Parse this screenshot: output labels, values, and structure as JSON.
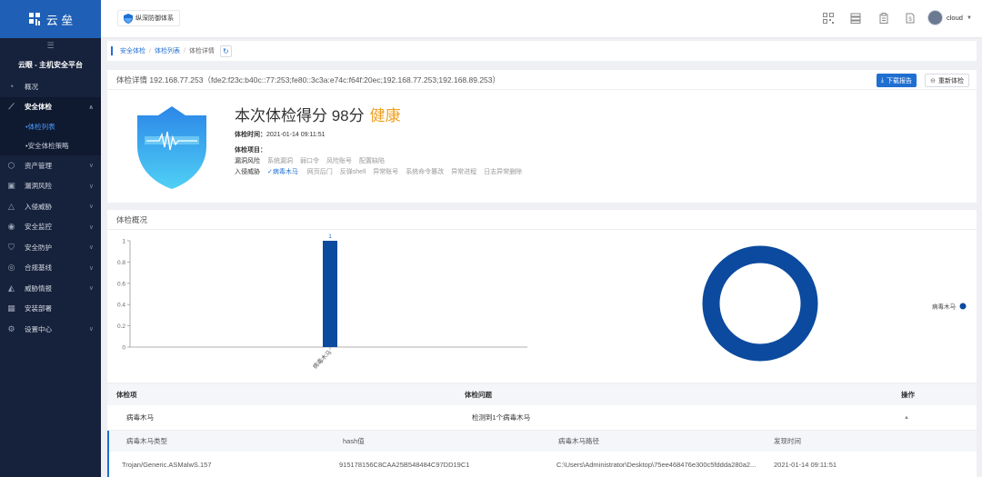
{
  "sidebar": {
    "logo_text": "云 垒",
    "platform": "云眼 - 主机安全平台",
    "items": [
      {
        "label": "概况",
        "icon": "dashboard-icon"
      },
      {
        "label": "安全体检",
        "icon": "trend-icon",
        "expanded": true
      },
      {
        "label": "资产管理",
        "icon": "cube-icon"
      },
      {
        "label": "漏洞风险",
        "icon": "lock-icon"
      },
      {
        "label": "入侵威胁",
        "icon": "warning-icon"
      },
      {
        "label": "安全监控",
        "icon": "eye-icon"
      },
      {
        "label": "安全防护",
        "icon": "shield-icon"
      },
      {
        "label": "合规基线",
        "icon": "radar-icon"
      },
      {
        "label": "威胁情报",
        "icon": "mountain-icon"
      },
      {
        "label": "安装部署",
        "icon": "grid-icon"
      },
      {
        "label": "设置中心",
        "icon": "gear-icon"
      }
    ],
    "submenu": [
      {
        "label": "•体检列表",
        "active": true
      },
      {
        "label": "•安全体检策略",
        "active": false
      }
    ]
  },
  "header": {
    "brand": "纵深防御体系",
    "user": "cloud"
  },
  "breadcrumb": {
    "items": [
      "安全体检",
      "体检列表",
      "体检详情"
    ]
  },
  "detail": {
    "title": "体检详情 192.168.77.253（fde2:f23c:b40c::77:253;fe80::3c3a:e74c:f64f:20ec;192.168.77.253;192.168.89.253）",
    "download_label": "下载报告",
    "recheck_label": "重新体检",
    "score_text": "本次体检得分 98分",
    "status_text": "健康",
    "time_label": "体检时间：",
    "time_value": "2021-01-14 09:11:51",
    "items_label": "体检项目：",
    "vuln_label": "漏洞风险",
    "vuln_items": [
      "系统漏洞",
      "弱口令",
      "风险账号",
      "配置缺陷"
    ],
    "intrusion_label": "入侵威胁",
    "intrusion_checked": "病毒木马",
    "intrusion_items": [
      "网页后门",
      "反弹shell",
      "异常账号",
      "系统命令篡改",
      "异常进程",
      "日志异常删除"
    ]
  },
  "overview": {
    "title": "体检概况"
  },
  "chart_data": [
    {
      "type": "bar",
      "categories": [
        "病毒木马"
      ],
      "values": [
        1
      ],
      "ylim": [
        0,
        1
      ],
      "yticks": [
        "0",
        "0.2",
        "0.4",
        "0.6",
        "0.8",
        "1"
      ],
      "data_labels": [
        "1"
      ],
      "color": "#0b4a9e"
    },
    {
      "type": "pie",
      "variant": "donut",
      "slices": [
        {
          "label": "病毒木马",
          "value": 1
        }
      ],
      "legend": "right",
      "color": "#0b4a9e"
    }
  ],
  "table": {
    "headers": [
      "体检项",
      "体检问题",
      "操作"
    ],
    "row": {
      "item": "病毒木马",
      "issue": "检测到1个病毒木马"
    },
    "sub_headers": [
      "病毒木马类型",
      "hash值",
      "病毒木马路径",
      "发现时间"
    ],
    "sub_row": {
      "type": "Trojan/Generic.ASMalwS.157",
      "hash": "915178156C8CAA25B548484C97DD19C1",
      "path": "C:\\Users\\Administrator\\Desktop\\75ee468476e300c5fddda280a2...",
      "time": "2021-01-14 09:11:51"
    }
  }
}
